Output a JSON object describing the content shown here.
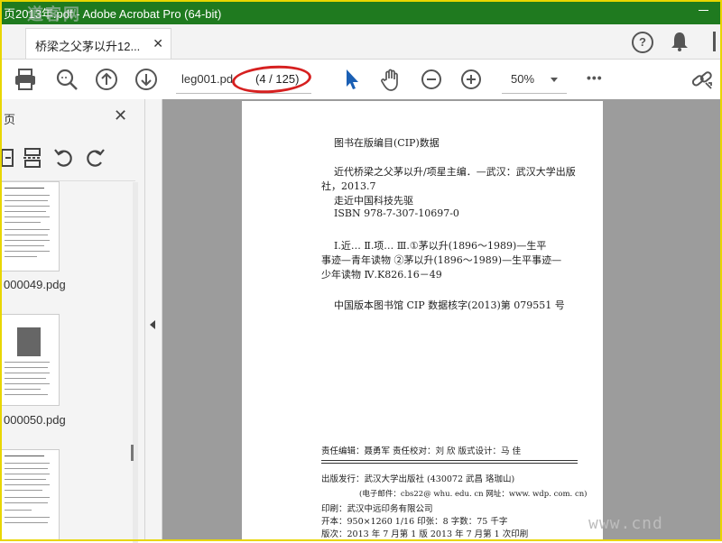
{
  "window": {
    "title": "页2013年.pdf - Adobe Acrobat Pro (64-bit)",
    "watermark_top": "道客网"
  },
  "tabs": [
    {
      "label": "桥梁之父茅以升12...",
      "close": "✕"
    }
  ],
  "header_right": {
    "help": "?"
  },
  "toolbar": {
    "file_name": "leg001.pd",
    "page_indicator": "(4 / 125)",
    "zoom": "50%",
    "more": "•••"
  },
  "left_panel": {
    "title": "页",
    "close": "✕",
    "thumbnails": [
      {
        "name": "000049.pdg"
      },
      {
        "name": "000050.pdg"
      },
      {
        "name": ""
      }
    ]
  },
  "document": {
    "heading": "图书在版编目(CIP)数据",
    "lines_block1": [
      "近代桥梁之父茅以升/项星主编．—武汉：武汉大学出版",
      "社，2013.7",
      "走近中国科技先驱",
      "ISBN 978-7-307-10697-0"
    ],
    "lines_block2": [
      "Ⅰ.近…   Ⅱ.项…   Ⅲ.①茅以升(1896～1989)—生平",
      "事迹—青年读物  ②茅以升(1896～1989)—生平事迹—",
      "少年读物  Ⅳ.K826.16－49"
    ],
    "cip_line": "中国版本图书馆 CIP 数据核字(2013)第 079551 号",
    "editors": "责任编辑：聂勇军     责任校对：刘  欣     版式设计：马  佳",
    "publisher": "出版发行：武汉大学出版社  (430072  武昌  珞珈山)",
    "email": "(电子邮件：cbs22@ whu. edu. cn 网址：www. wdp. com. cn)",
    "printer": "印刷：武汉中远印务有限公司",
    "format": "开本：950×1260  1/16   印张：8   字数：75 千字",
    "edition": "版次：2013 年 7 月第 1 版      2013 年 7 月第 1 次印刷"
  },
  "watermark_bottom": "www.cnd"
}
